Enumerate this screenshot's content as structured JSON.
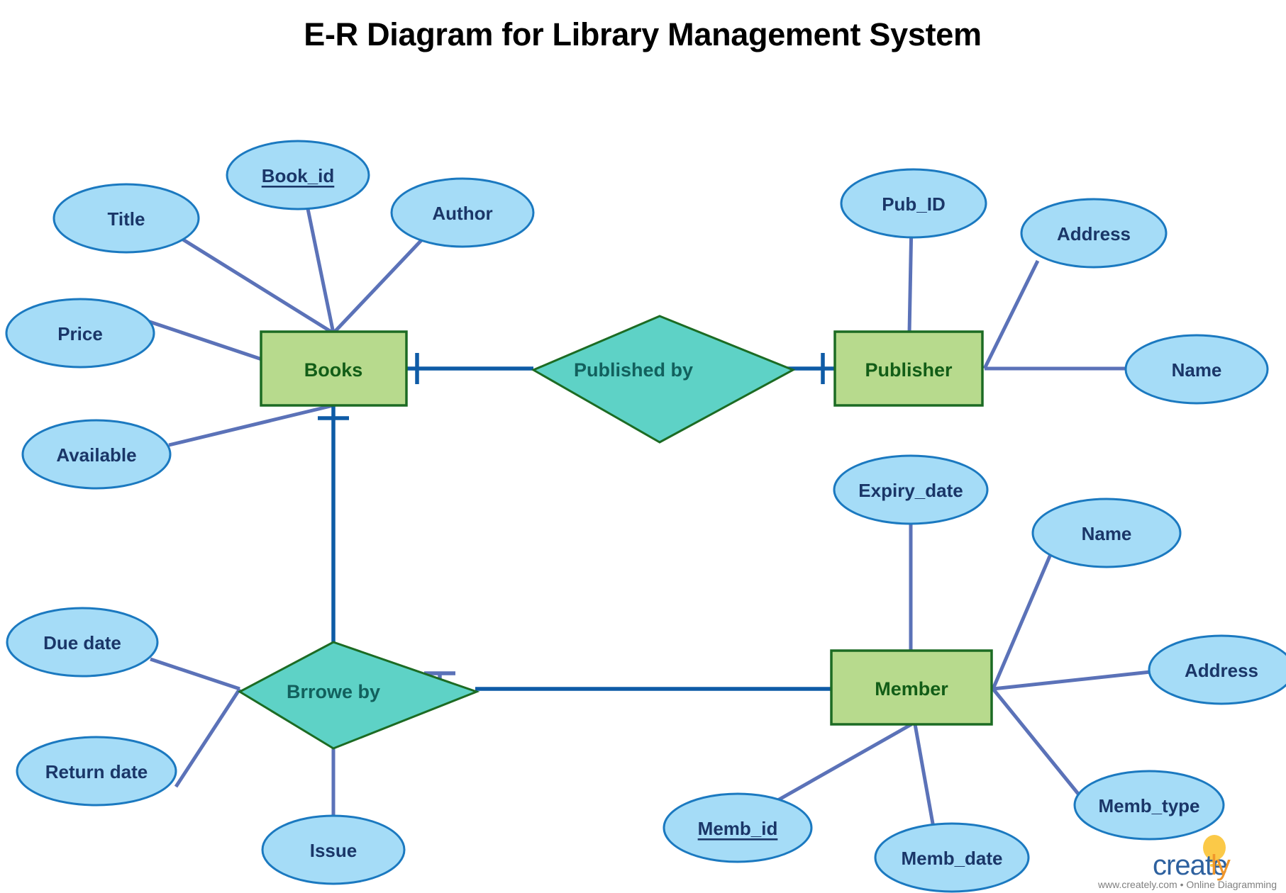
{
  "title": "E-R Diagram for Library Management System",
  "palette": {
    "entity_fill": "#b7da8d",
    "entity_stroke": "#1c6b23",
    "entity_text": "#125d17",
    "relationship_fill": "#5ed2c6",
    "relationship_stroke": "#1c6b23",
    "relationship_text": "#12605d",
    "attribute_fill": "#a5dcf7",
    "attribute_stroke": "#1b79c0",
    "attribute_text": "#1a3668",
    "attribute_link": "#5b72b8",
    "relationship_link": "#0e5ba6",
    "title_text": "#000000",
    "background": "#ffffff"
  },
  "entities": [
    {
      "id": "books",
      "label": "Books"
    },
    {
      "id": "publisher",
      "label": "Publisher"
    },
    {
      "id": "member",
      "label": "Member"
    }
  ],
  "relationships": [
    {
      "id": "published_by",
      "label": "Published by",
      "connects": [
        "Books",
        "Publisher"
      ]
    },
    {
      "id": "brrowe_by",
      "label": "Brrowe by",
      "connects": [
        "Books",
        "Member"
      ]
    }
  ],
  "attributes": [
    {
      "id": "book_title",
      "label": "Title",
      "owner": "Books",
      "is_key": false
    },
    {
      "id": "book_id",
      "label": "Book_id",
      "owner": "Books",
      "is_key": true
    },
    {
      "id": "book_author",
      "label": "Author",
      "owner": "Books",
      "is_key": false
    },
    {
      "id": "book_price",
      "label": "Price",
      "owner": "Books",
      "is_key": false
    },
    {
      "id": "book_avail",
      "label": "Available",
      "owner": "Books",
      "is_key": false
    },
    {
      "id": "pub_id",
      "label": "Pub_ID",
      "owner": "Publisher",
      "is_key": false
    },
    {
      "id": "pub_address",
      "label": "Address",
      "owner": "Publisher",
      "is_key": false
    },
    {
      "id": "pub_name",
      "label": "Name",
      "owner": "Publisher",
      "is_key": false
    },
    {
      "id": "mem_expiry",
      "label": "Expiry_date",
      "owner": "Member",
      "is_key": false
    },
    {
      "id": "mem_name",
      "label": "Name",
      "owner": "Member",
      "is_key": false
    },
    {
      "id": "mem_address",
      "label": "Address",
      "owner": "Member",
      "is_key": false
    },
    {
      "id": "mem_type",
      "label": "Memb_type",
      "owner": "Member",
      "is_key": false
    },
    {
      "id": "mem_id",
      "label": "Memb_id",
      "owner": "Member",
      "is_key": true
    },
    {
      "id": "mem_date",
      "label": "Memb_date",
      "owner": "Member",
      "is_key": false
    },
    {
      "id": "due_date",
      "label": "Due date",
      "owner": "Brrowe by",
      "is_key": false
    },
    {
      "id": "return_date",
      "label": "Return date",
      "owner": "Brrowe by",
      "is_key": false
    },
    {
      "id": "issue",
      "label": "Issue",
      "owner": "Brrowe by",
      "is_key": false
    }
  ],
  "watermark": {
    "brand_primary": "create",
    "brand_accent": "ly",
    "tagline": "www.creately.com • Online Diagramming"
  }
}
